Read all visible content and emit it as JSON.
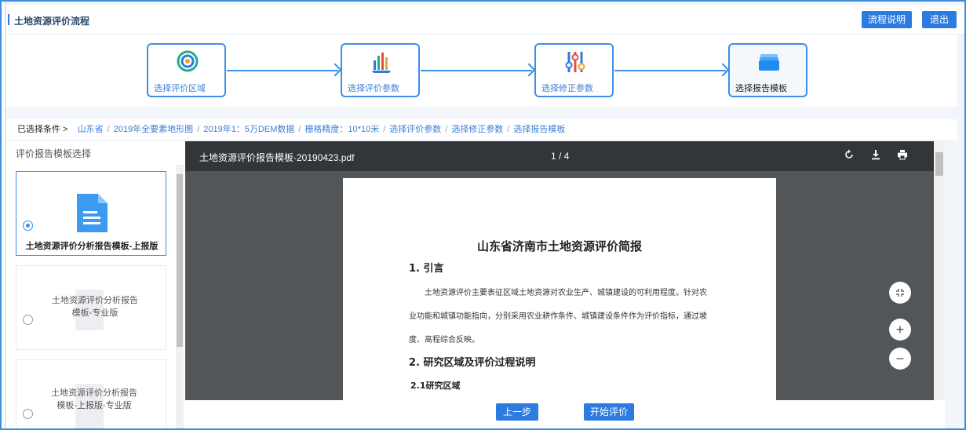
{
  "header": {
    "title": "土地资源评价流程",
    "help_label": "流程说明",
    "exit_label": "退出"
  },
  "flow": {
    "steps": [
      {
        "label": "选择评价区域",
        "icon": "target-icon"
      },
      {
        "label": "选择评价参数",
        "icon": "bar-chart-icon"
      },
      {
        "label": "选择修正参数",
        "icon": "sliders-icon"
      },
      {
        "label": "选择报告模板",
        "icon": "layers-icon"
      }
    ],
    "active_index": 3
  },
  "breadcrumb": {
    "lead": "已选择条件 >",
    "items": [
      "山东省",
      "2019年全要素地形图",
      "2019年1：5万DEM数据",
      "栅格精度：10*10米",
      "选择评价参数",
      "选择修正参数",
      "选择报告模板"
    ],
    "separator": "/"
  },
  "template_panel": {
    "heading": "评价报告模板选择",
    "cards": [
      {
        "name": "土地资源评价分析报告模板-上报版",
        "selected": true
      },
      {
        "name": "土地资源评价分析报告模板-专业版",
        "selected": false
      },
      {
        "name": "土地资源评价分析报告模板-上报版-专业版",
        "selected": false
      }
    ]
  },
  "pdf_viewer": {
    "filename": "土地资源评价报告模板-20190423.pdf",
    "page_indicator": "1 / 4",
    "document": {
      "title": "山东省济南市土地资源评价简报",
      "section1": "1. 引言",
      "para1_line1": "土地资源评价主要表征区域土地资源对农业生产、城镇建设的可利用程度。针对农",
      "para1_line2": "业功能和城镇功能指向，分别采用农业耕作条件、城镇建设条件作为评价指标，通过坡",
      "para1_line3": "度、高程综合反映。",
      "section2": "2. 研究区域及评价过程说明",
      "section2_1": "2.1研究区域"
    },
    "zoom_in": "+",
    "zoom_out": "−"
  },
  "actions": {
    "prev_label": "上一步",
    "start_label": "开始评价"
  },
  "colors": {
    "accent": "#2d7be0",
    "viewer_bg": "#525659",
    "toolbar_bg": "#323639"
  }
}
